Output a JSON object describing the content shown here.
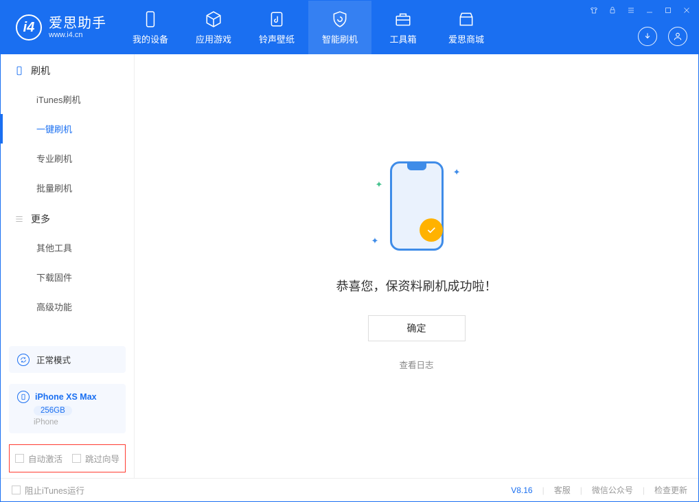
{
  "app": {
    "title": "爱思助手",
    "subtitle": "www.i4.cn"
  },
  "nav": [
    {
      "id": "device",
      "label": "我的设备"
    },
    {
      "id": "apps",
      "label": "应用游戏"
    },
    {
      "id": "ring",
      "label": "铃声壁纸"
    },
    {
      "id": "flash",
      "label": "智能刷机"
    },
    {
      "id": "tools",
      "label": "工具箱"
    },
    {
      "id": "store",
      "label": "爱思商城"
    }
  ],
  "sidebar": {
    "section_flash": "刷机",
    "items_flash": [
      {
        "label": "iTunes刷机"
      },
      {
        "label": "一键刷机"
      },
      {
        "label": "专业刷机"
      },
      {
        "label": "批量刷机"
      }
    ],
    "section_more": "更多",
    "items_more": [
      {
        "label": "其他工具"
      },
      {
        "label": "下载固件"
      },
      {
        "label": "高级功能"
      }
    ]
  },
  "mode": {
    "label": "正常模式"
  },
  "device": {
    "name": "iPhone XS Max",
    "capacity": "256GB",
    "type": "iPhone"
  },
  "options": {
    "auto_activate": "自动激活",
    "skip_wizard": "跳过向导"
  },
  "result": {
    "message": "恭喜您，保资料刷机成功啦！",
    "ok": "确定",
    "view_log": "查看日志"
  },
  "footer": {
    "block_itunes": "阻止iTunes运行",
    "version": "V8.16",
    "support": "客服",
    "wechat": "微信公众号",
    "update": "检查更新"
  }
}
